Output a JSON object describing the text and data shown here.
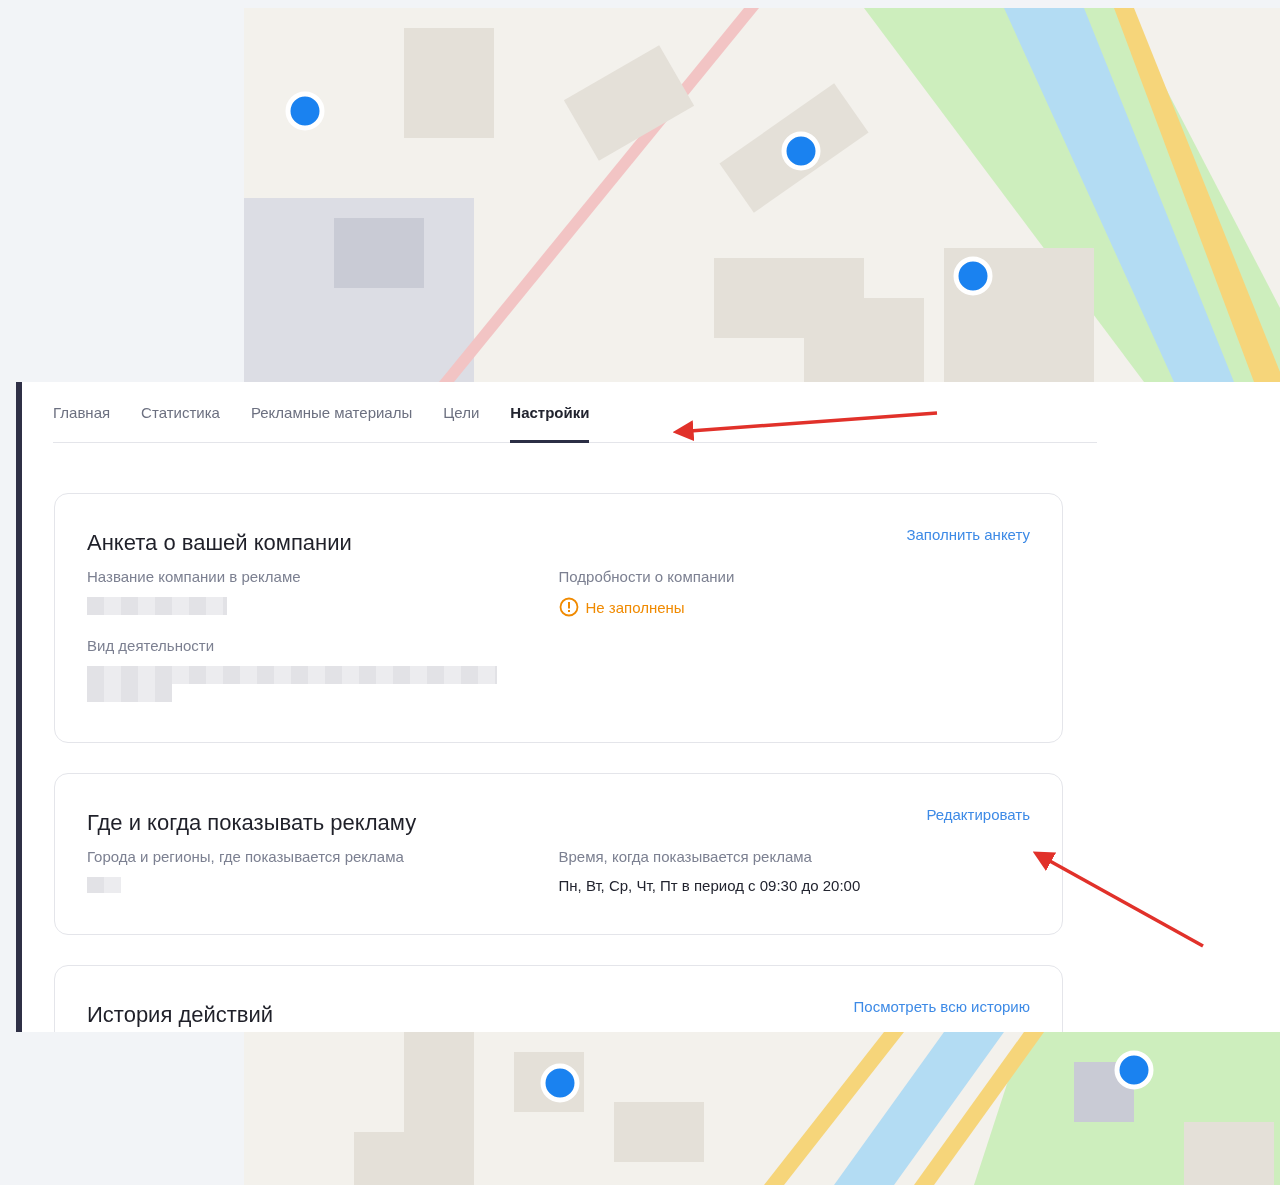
{
  "tabs": [
    {
      "label": "Главная",
      "selected": false
    },
    {
      "label": "Статистика",
      "selected": false
    },
    {
      "label": "Рекламные материалы",
      "selected": false
    },
    {
      "label": "Цели",
      "selected": false
    },
    {
      "label": "Настройки",
      "selected": true
    }
  ],
  "cards": [
    {
      "title": "Анкета о вашей компании",
      "action": "Заполнить анкету",
      "columns": [
        [
          {
            "label": "Название компании в рекламе",
            "kind": "redacted"
          },
          {
            "label": "Вид деятельности",
            "kind": "redacted"
          }
        ],
        [
          {
            "label": "Подробности о компании",
            "kind": "warning",
            "value": "Не заполнены"
          }
        ]
      ]
    },
    {
      "title": "Где и когда показывать рекламу",
      "action": "Редактировать",
      "columns": [
        [
          {
            "label": "Города и регионы, где показывается реклама",
            "kind": "redacted"
          }
        ],
        [
          {
            "label": "Время, когда показывается реклама",
            "kind": "text",
            "value": "Пн, Вт, Ср, Чт, Пт в период с 09:30 до 20:00"
          }
        ]
      ]
    },
    {
      "title": "История действий",
      "action": "Посмотреть всю историю"
    }
  ]
}
